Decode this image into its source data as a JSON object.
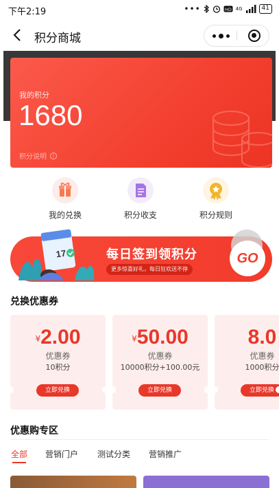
{
  "status_bar": {
    "time": "下午2:19",
    "network": "4G",
    "battery": "41"
  },
  "nav": {
    "title": "积分商城"
  },
  "points": {
    "label": "我的积分",
    "value": "1680",
    "explain": "积分说明",
    "info_glyph": "i"
  },
  "quick_actions": [
    {
      "label": "我的兑换",
      "icon": "gift-icon",
      "color": "#f57a4f"
    },
    {
      "label": "积分收支",
      "icon": "document-icon",
      "color": "#a774e6"
    },
    {
      "label": "积分规则",
      "icon": "medal-icon",
      "color": "#f2b52b"
    }
  ],
  "checkin_banner": {
    "title": "每日签到领积分",
    "subtitle": "更多惊喜好礼，每日狂欢送不停",
    "go": "GO",
    "calendar_day": "17"
  },
  "coupons_section": {
    "title": "兑换优惠券"
  },
  "coupons": [
    {
      "currency": "¥",
      "amount": "2.00",
      "type": "优惠券",
      "cost": "10积分",
      "button": "立即兑换"
    },
    {
      "currency": "¥",
      "amount": "50.00",
      "type": "优惠券",
      "cost": "10000积分+100.00元",
      "button": "立即兑换"
    },
    {
      "currency": "",
      "amount": "8.0",
      "type": "优惠券",
      "cost": "1000积分",
      "button": "立即兑换"
    }
  ],
  "products_section": {
    "title": "优惠购专区"
  },
  "tabs": [
    "全部",
    "营销门户",
    "测试分类",
    "营销推广"
  ],
  "colors": {
    "accent": "#e8382a",
    "card": "#f3402f",
    "coupon_bg": "#fdeeed"
  }
}
